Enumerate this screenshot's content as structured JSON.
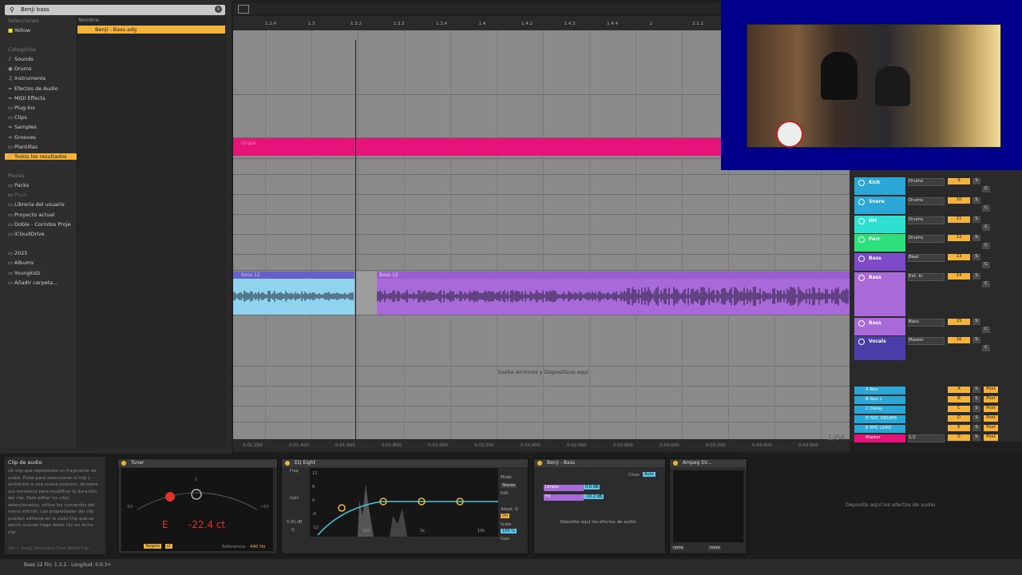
{
  "browser": {
    "search_value": "Benji bass",
    "collections_header": "Selecciones",
    "collection_yellow": "Yellow",
    "categories_header": "Categorías",
    "categories": [
      "Sounds",
      "Drums",
      "Instruments",
      "Efectos de Audio",
      "MIDI Effects",
      "Plug-Ins",
      "Clips",
      "Samples",
      "Grooves",
      "Plantillas",
      "Todos los resultados"
    ],
    "places_header": "Places",
    "places": [
      "Packs",
      "Push",
      "Librería del usuario",
      "Proyecto actual",
      "Doble - Corridos Proje",
      "iCloudDrive",
      "2025",
      "Albums",
      "Youngkidz",
      "Añadir carpeta..."
    ],
    "column_header": "Nombre",
    "file_selected": "Benji - Bass.adg"
  },
  "ruler": [
    "1.2.4",
    "1.3",
    "1.3.2",
    "1.3.3",
    "1.3.4",
    "1.4",
    "1.4.2",
    "1.4.3",
    "1.4.4",
    "2",
    "2.1.2"
  ],
  "bottom_ruler": [
    "0:01:200",
    "0:01:400",
    "0:01:600",
    "0:01:800",
    "0:02:000",
    "0:02:200",
    "0:02:400",
    "0:02:600",
    "0:02:800",
    "0:03:000",
    "0:03:200",
    "0:03:400",
    "0:03:600"
  ],
  "arrangement": {
    "group_clip_name": "Grupo",
    "clip1_name": "Bass 12",
    "clip2_name": "Bass 12",
    "drop_text": "Suelte Archivos y Dispositivos aquí",
    "zoom": "1/64"
  },
  "mixer": {
    "tracks": [
      {
        "name": "Kick",
        "io": "Drums",
        "num": "9",
        "color": "#2aa7d6"
      },
      {
        "name": "Snare",
        "io": "Drums",
        "num": "10",
        "color": "#2aa7d6"
      },
      {
        "name": "HH",
        "io": "Drums",
        "num": "11",
        "color": "#2de0cf"
      },
      {
        "name": "Perc",
        "io": "Drums",
        "num": "12",
        "color": "#2de07a"
      },
      {
        "name": "Bass",
        "io": "Beat",
        "num": "13",
        "color": "#7d4bc9"
      },
      {
        "name": "Bass",
        "io": "Ext. In",
        "num": "14",
        "color": "#a86ad9"
      },
      {
        "name": "Bass",
        "io": "Bass",
        "num": "15",
        "color": "#a86ad9"
      },
      {
        "name": "Vocals",
        "io": "Master",
        "num": "16",
        "color": "#4a3fa8"
      }
    ],
    "returns": [
      {
        "name": "A Rev",
        "letter": "A"
      },
      {
        "name": "B Rev 2",
        "letter": "B"
      },
      {
        "name": "C Delay",
        "letter": "C"
      },
      {
        "name": "D NYC DRUMS",
        "letter": "D"
      },
      {
        "name": "E NYC LEAD",
        "letter": "E"
      },
      {
        "name": "Master",
        "letter": "0"
      }
    ],
    "solo_label": "S",
    "cue_label": "C",
    "post_label": "Post",
    "master_io": "1/2"
  },
  "info_panel": {
    "title": "Clip de audio",
    "body": "Un clip que representa un fragmento de audio. Pulse para seleccionar el clip y arrástrelo a una nueva posición. Arrastre sus extremos para modificar la duración del clip. Para editar los clips seleccionados, utilice los comandos del menú edición. Las propiedades del clip pueden editarse en la vista Clip que se abrirá cuando haga doble clic en dicho clip.",
    "footer": "(Alt + Drag) Seleccione Time Within Clip"
  },
  "tuner": {
    "title": "Tuner",
    "note": "E",
    "cents": "-22.4 ct",
    "reference_label": "Referencia",
    "reference_value": "440 Hz",
    "scale_zero": "0",
    "scale_left": "-50",
    "scale_right": "+50",
    "mode_a": "Targets",
    "mode_b": "ct"
  },
  "eq": {
    "title": "EQ Eight",
    "freq_label": "Freq",
    "gain_label": "Gain",
    "q_label": "Q",
    "mode_label": "Mode",
    "mode_value": "Stereo",
    "edit_label": "Edit",
    "adapt_label": "Adapt. Q",
    "on_label": "On",
    "scale_label": "Scale",
    "scale_value": "100 %",
    "gain_value": "0.00 dB",
    "db_ticks": [
      "12",
      "6",
      "0",
      "-6",
      "-12"
    ],
    "freq_ticks": [
      "100",
      "1k",
      "10k"
    ]
  },
  "rack": {
    "title": "Benji - Bass",
    "chain_label": "Chain",
    "chain_btn": "Auto",
    "chain1": "Limpio",
    "chain1_vol": "0.0 dB",
    "chain2": "FX",
    "chain2_vol": "-10.2 dB",
    "drop_text": "Deposite aquí los efectos de audio"
  },
  "ampeg": {
    "title": "Ampeg SV...",
    "sel1": "none",
    "sel2": "none"
  },
  "drop_audio": "Deposite aquí los efectos de audio",
  "status": "Bass 12  Fin: 1.3.2 - Longitud: 0.0.3+"
}
